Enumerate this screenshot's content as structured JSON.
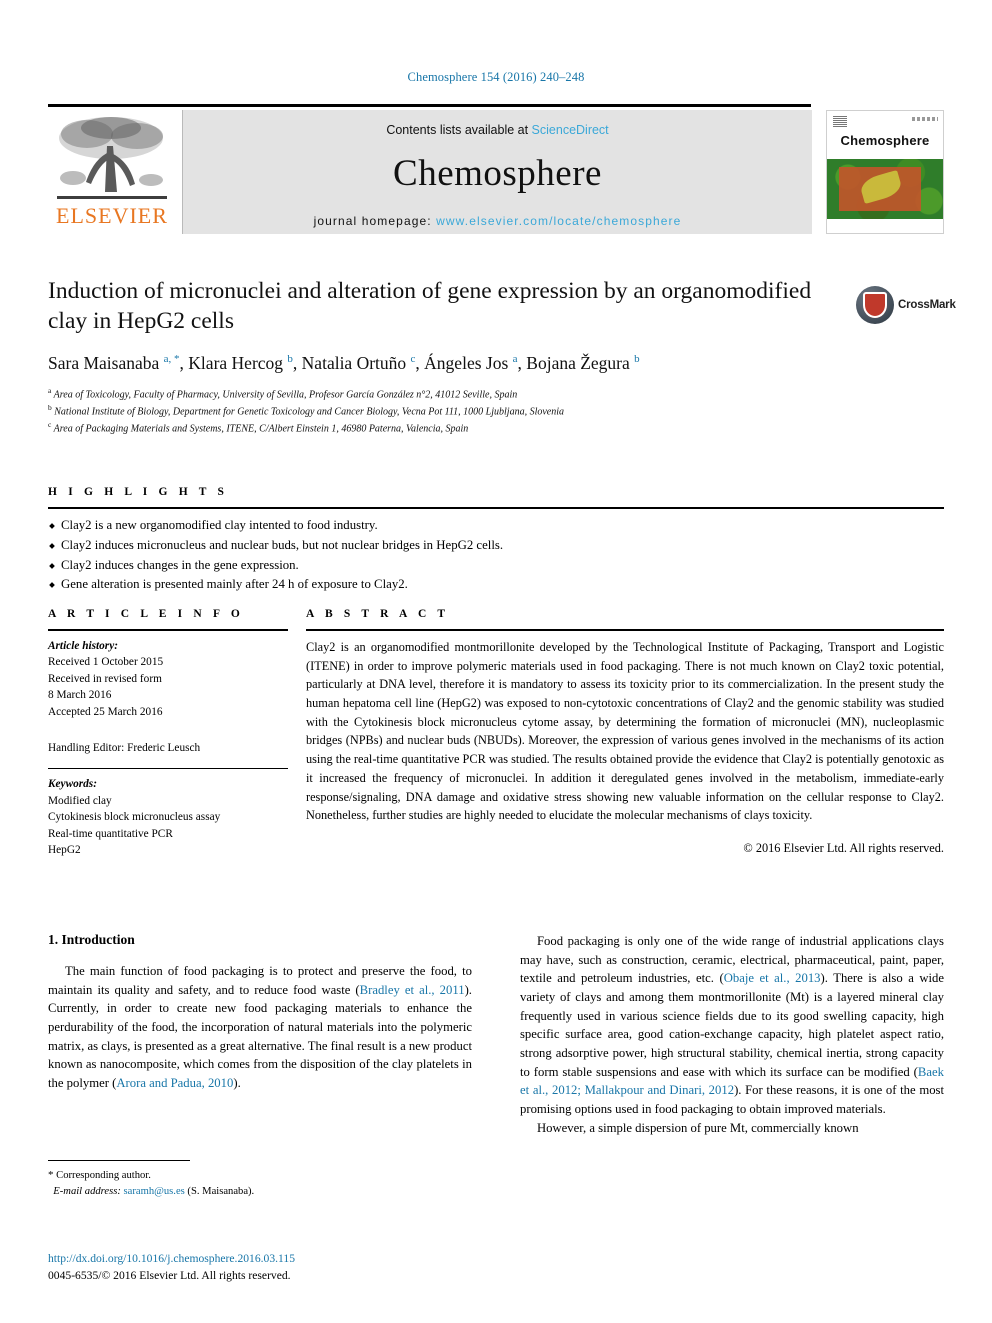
{
  "running_head": "Chemosphere 154 (2016) 240–248",
  "masthead": {
    "contents_prefix": "Contents lists available at ",
    "sciencedirect": "ScienceDirect",
    "journal_title": "Chemosphere",
    "homepage_prefix": "journal homepage: ",
    "homepage_url": "www.elsevier.com/locate/chemosphere",
    "publisher": "ELSEVIER",
    "cover_name": "Chemosphere"
  },
  "crossmark": {
    "label": "CrossMark"
  },
  "article": {
    "title": "Induction of micronuclei and alteration of gene expression by an organomodified clay in HepG2 cells",
    "authors_html": "Sara Maisanaba <sup>a, *</sup>, Klara Hercog <sup>b</sup>, Natalia Ortuño <sup>c</sup>, Ángeles Jos <sup>a</sup>, Bojana Žegura <sup>b</sup>",
    "affiliations": [
      {
        "marker": "a",
        "text": "Area of Toxicology, Faculty of Pharmacy, University of Sevilla, Profesor García González n°2, 41012 Seville, Spain"
      },
      {
        "marker": "b",
        "text": "National Institute of Biology, Department for Genetic Toxicology and Cancer Biology, Vecna Pot 111, 1000 Ljubljana, Slovenia"
      },
      {
        "marker": "c",
        "text": "Area of Packaging Materials and Systems, ITENE, C/Albert Einstein 1, 46980 Paterna, Valencia, Spain"
      }
    ]
  },
  "highlights": {
    "label": "H I G H L I G H T S",
    "items": [
      "Clay2 is a new organomodified clay intented to food industry.",
      "Clay2 induces micronucleus and nuclear buds, but not nuclear bridges in HepG2 cells.",
      "Clay2 induces changes in the gene expression.",
      "Gene alteration is presented mainly after 24 h of exposure to Clay2."
    ]
  },
  "article_info": {
    "label": "A R T I C L E    I N F O",
    "history_head": "Article history:",
    "history_lines": [
      "Received 1 October 2015",
      "Received in revised form",
      "8 March 2016",
      "Accepted 25 March 2016"
    ],
    "handling_editor": "Handling Editor: Frederic Leusch",
    "keywords_head": "Keywords:",
    "keywords": [
      "Modified clay",
      "Cytokinesis block micronucleus assay",
      "Real-time quantitative PCR",
      "HepG2"
    ]
  },
  "abstract": {
    "label": "A B S T R A C T",
    "text": "Clay2 is an organomodified montmorillonite developed by the Technological Institute of Packaging, Transport and Logistic (ITENE) in order to improve polymeric materials used in food packaging. There is not much known on Clay2 toxic potential, particularly at DNA level, therefore it is mandatory to assess its toxicity prior to its commercialization. In the present study the human hepatoma cell line (HepG2) was exposed to non-cytotoxic concentrations of Clay2 and the genomic stability was studied with the Cytokinesis block micronucleus cytome assay, by determining the formation of micronuclei (MN), nucleoplasmic bridges (NPBs) and nuclear buds (NBUDs). Moreover, the expression of various genes involved in the mechanisms of its action using the real-time quantitative PCR was studied. The results obtained provide the evidence that Clay2 is potentially genotoxic as it increased the frequency of micronuclei. In addition it deregulated genes involved in the metabolism, immediate-early response/signaling, DNA damage and oxidative stress showing new valuable information on the cellular response to Clay2. Nonetheless, further studies are highly needed to elucidate the molecular mechanisms of clays toxicity.",
    "copyright": "© 2016 Elsevier Ltd. All rights reserved."
  },
  "introduction": {
    "heading": "1. Introduction",
    "left_paragraph_1_a": "The main function of food packaging is to protect and preserve the food, to maintain its quality and safety, and to reduce food waste (",
    "left_cite_1": "Bradley et al., 2011",
    "left_paragraph_1_b": "). Currently, in order to create new food packaging materials to enhance the perdurability of the food, the incorporation of natural materials into the polymeric matrix, as clays, is presented as a great alternative. The final result is a new product known as nanocomposite, which comes from the disposition of the clay platelets in the polymer (",
    "left_cite_2": "Arora and Padua, 2010",
    "left_paragraph_1_c": ").",
    "right_paragraph_1_a": "Food packaging is only one of the wide range of industrial applications clays may have, such as construction, ceramic, electrical, pharmaceutical, paint, paper, textile and petroleum industries, etc. (",
    "right_cite_1": "Obaje et al., 2013",
    "right_paragraph_1_b": "). There is also a wide variety of clays and among them montmorillonite (Mt) is a layered mineral clay frequently used in various science fields due to its good swelling capacity, high specific surface area, good cation-exchange capacity, high platelet aspect ratio, strong adsorptive power, high structural stability, chemical inertia, strong capacity to form stable suspensions and ease with which its surface can be modified (",
    "right_cite_2": "Baek et al., 2012; Mallakpour and Dinari, 2012",
    "right_paragraph_1_c": "). For these reasons, it is one of the most promising options used in food packaging to obtain improved materials.",
    "right_paragraph_2": "However, a simple dispersion of pure Mt, commercially known"
  },
  "footnote": {
    "corresponding": "Corresponding author.",
    "email_label": "E-mail address: ",
    "email": "saramh@us.es",
    "email_suffix": " (S. Maisanaba).",
    "doi_url": "http://dx.doi.org/10.1016/j.chemosphere.2016.03.115",
    "issn_line": "0045-6535/© 2016 Elsevier Ltd. All rights reserved."
  },
  "colors": {
    "link": "#1876a8",
    "sciencedirect": "#3ba8d8",
    "elsevier_orange": "#e87722",
    "masthead_bg": "#e3e3e3"
  }
}
